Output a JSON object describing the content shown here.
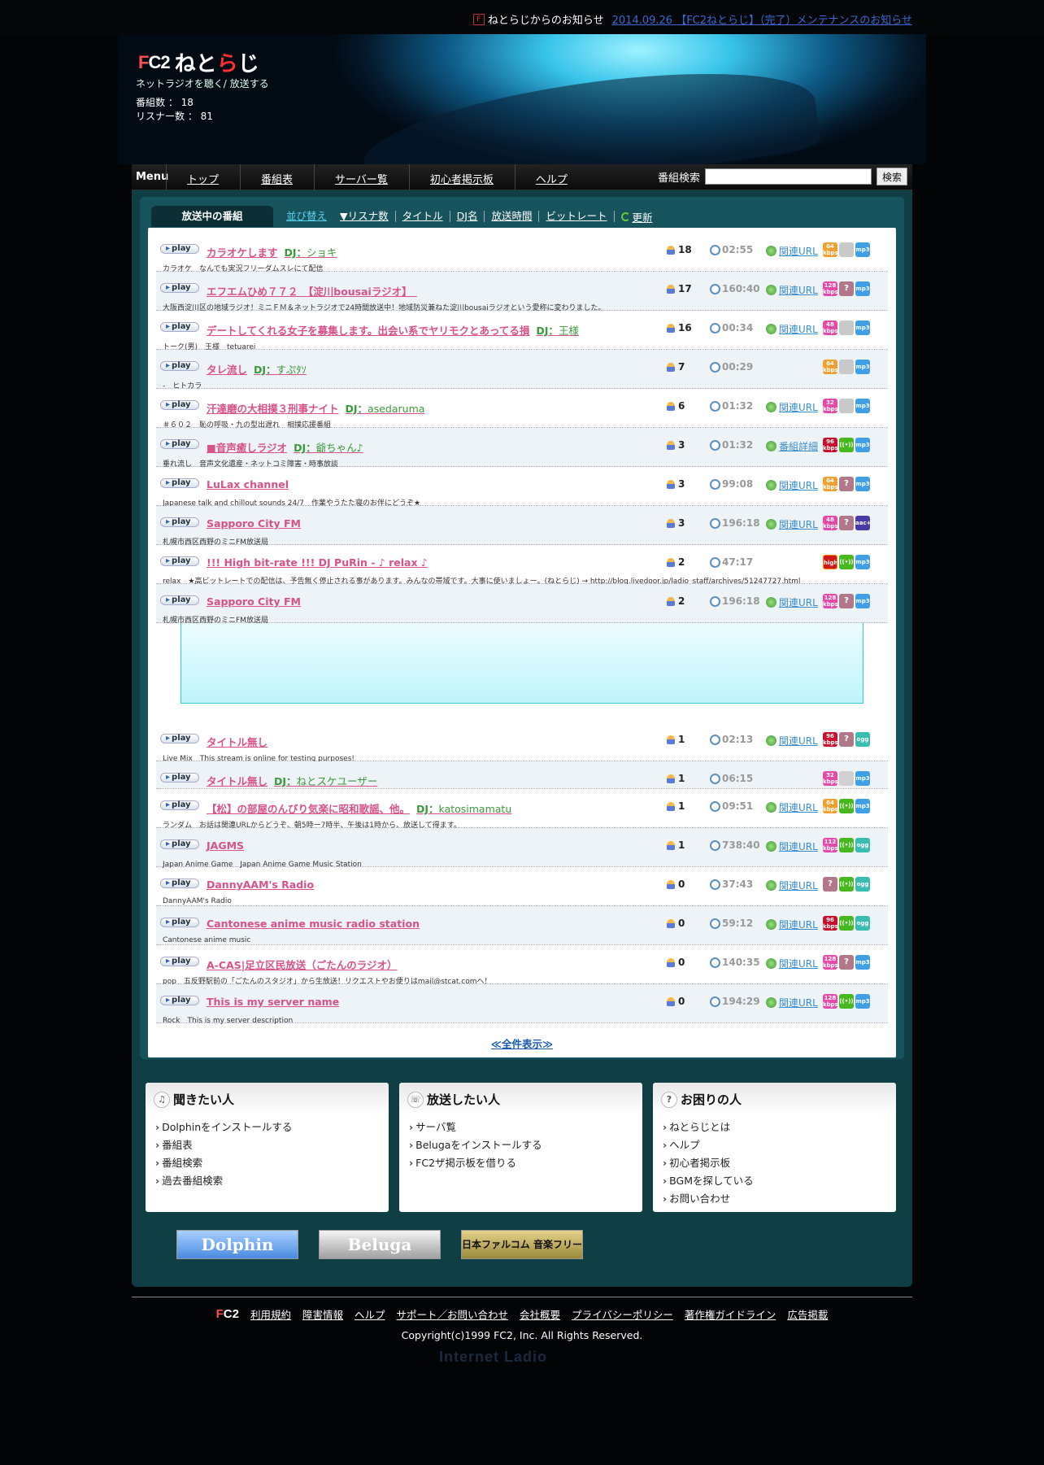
{
  "topbar": {
    "site_notice_label": "ねとらじからのお知らせ",
    "notice_link": "2014.09.26 【FC2ねとらじ】（完了）メンテナンスのお知らせ"
  },
  "header": {
    "logo_fc2": "FC2",
    "logo_jp": "ねとらじ",
    "tagline": "ネットラジオを聴く/ 放送する",
    "program_count": "番組数 ： 18",
    "listener_count": "リスナー数 ： 81"
  },
  "nav": {
    "menu_label": "Menu",
    "items": [
      "トップ",
      "番組表",
      "サーバー覧",
      "初心者掲示板",
      "ヘルプ"
    ],
    "search_label": "番組検索",
    "search_button": "検索"
  },
  "list": {
    "tab_label": "放送中の番組",
    "sort_label": "並び替え",
    "sort_options": [
      "▼リスナ数",
      "タイトル",
      "DJ名",
      "放送時間",
      "ビットレート"
    ],
    "refresh_label": "更新",
    "play_label": "play",
    "show_all": "≪全件表示≫",
    "rows": [
      {
        "title": "カラオケしますDJ：ショキ",
        "desc": "カラオケ　なんでも実況フリーダムスレにて配信",
        "listeners": "18",
        "time": "02:55",
        "link": "関連URL",
        "badges": [
          [
            "orange",
            "64 kbps"
          ],
          [
            "gray",
            ""
          ],
          [
            "mp3",
            "mp3"
          ]
        ]
      },
      {
        "title": "エフエムひめ７７２　【淀川bousaiラジオ】　",
        "desc": "大阪西淀川区の地域ラジオ！ミニＦＭ＆ネットラジオで24時間放送中！地域防災兼ねた淀川bousaiラジオという愛称に変わりました。",
        "listeners": "17",
        "time": "160:40",
        "link": "関連URL",
        "badges": [
          [
            "pink",
            "128 kbps"
          ],
          [
            "q",
            "?"
          ],
          [
            "mp3",
            "mp3"
          ]
        ]
      },
      {
        "title": "デートしてくれる女子を募集します。出会い系でヤリモクとあってる損DJ：王様",
        "desc": "トーク(男)　王様　tetuarei",
        "listeners": "16",
        "time": "00:34",
        "link": "関連URL",
        "badges": [
          [
            "pink",
            "48 kbps"
          ],
          [
            "gray",
            ""
          ],
          [
            "mp3",
            "mp3"
          ]
        ]
      },
      {
        "title": "タレ流しDJ：すぷﾀｿ",
        "desc": "-　ヒトカラ",
        "listeners": "7",
        "time": "00:29",
        "link": "",
        "badges": [
          [
            "orange",
            "64 kbps"
          ],
          [
            "gray",
            ""
          ],
          [
            "mp3",
            "mp3"
          ]
        ]
      },
      {
        "title": "汗達磨の大相撲３刑事ナイトDJ：asedaruma",
        "desc": "＃６０２　恥の呼吸・九の型出遅れ　相撲応援番組",
        "listeners": "6",
        "time": "01:32",
        "link": "関連URL",
        "badges": [
          [
            "pink",
            "32 kbps"
          ],
          [
            "gray",
            ""
          ],
          [
            "mp3",
            "mp3"
          ]
        ]
      },
      {
        "title": "■音声癒しラジオDJ：爺ちゃん♪",
        "desc": "垂れ流し　音声文化遺産・ネットコミ障害・時事放談",
        "listeners": "3",
        "time": "01:32",
        "link": "番組詳細",
        "badges": [
          [
            "red",
            "96 kbps"
          ],
          [
            "green",
            "((•))"
          ],
          [
            "mp3",
            "mp3"
          ]
        ]
      },
      {
        "title": "LuLax channel",
        "desc": "Japanese talk and chillout sounds 24/7　作業やうたた寝のお伴にどうぞ★",
        "listeners": "3",
        "time": "99:08",
        "link": "関連URL",
        "badges": [
          [
            "orange",
            "64 kbps"
          ],
          [
            "q",
            "?"
          ],
          [
            "mp3",
            "mp3"
          ]
        ]
      },
      {
        "title": "Sapporo City FM",
        "desc": "札幌市西区西野のミニFM放送局",
        "listeners": "3",
        "time": "196:18",
        "link": "関連URL",
        "badges": [
          [
            "pink",
            "48 kbps"
          ],
          [
            "q",
            "?"
          ],
          [
            "aac",
            "aac+"
          ]
        ]
      },
      {
        "title": "!!! High bit-rate !!! DJ PuRin - ♪ relax ♪",
        "desc": "relax　★高ビットレートでの配信は、予告無く停止される事があります。みんなの帯域です。大事に使いましょー。(ねとらじ) → http://blog.livedoor.jp/ladio_staff/archives/51247727.html",
        "listeners": "2",
        "time": "47:17",
        "link": "",
        "badges": [
          [
            "high",
            "high"
          ],
          [
            "green",
            "((•))"
          ],
          [
            "mp3",
            "mp3"
          ]
        ]
      },
      {
        "title": "Sapporo City FM",
        "desc": "札幌市西区西野のミニFM放送局",
        "listeners": "2",
        "time": "196:18",
        "link": "関連URL",
        "badges": [
          [
            "pink",
            "128 kbps"
          ],
          [
            "q",
            "?"
          ],
          [
            "mp3",
            "mp3"
          ]
        ]
      },
      {
        "title": "タイトル無し",
        "desc": "Live Mix　This stream is online for testing purposes!",
        "listeners": "1",
        "time": "02:13",
        "link": "関連URL",
        "badges": [
          [
            "red",
            "96 kbps"
          ],
          [
            "q",
            "?"
          ],
          [
            "ogg",
            "ogg"
          ]
        ]
      },
      {
        "title": "タイトル無しDJ：ねとスケユーザー",
        "desc": "",
        "listeners": "1",
        "time": "06:15",
        "link": "",
        "badges": [
          [
            "pink",
            "32 kbps"
          ],
          [
            "lgray",
            ""
          ],
          [
            "mp3",
            "mp3"
          ]
        ]
      },
      {
        "title": "【松】の部屋のんびり気楽に昭和歌謡、他。DJ：katosimamatu",
        "desc": "ランダム　お話は関連URLからどうぞ、朝5時ー7時半、午後は1時から、放送して得ます。",
        "listeners": "1",
        "time": "09:51",
        "link": "関連URL",
        "badges": [
          [
            "orange",
            "64 kbps"
          ],
          [
            "green",
            "((•))"
          ],
          [
            "mp3",
            "mp3"
          ]
        ]
      },
      {
        "title": "JAGMS",
        "desc": "Japan Anime Game　Japan Anime Game Music Station",
        "listeners": "1",
        "time": "738:40",
        "link": "関連URL",
        "badges": [
          [
            "pink",
            "112 kbps"
          ],
          [
            "green",
            "((•))"
          ],
          [
            "ogg",
            "ogg"
          ]
        ]
      },
      {
        "title": "DannyAAM's Radio",
        "desc": "DannyAAM's Radio",
        "listeners": "0",
        "time": "37:43",
        "link": "関連URL",
        "badges": [
          [
            "q",
            "?"
          ],
          [
            "green",
            "((•))"
          ],
          [
            "ogg",
            "ogg"
          ]
        ]
      },
      {
        "title": "Cantonese anime music radio station",
        "desc": "Cantonese anime music",
        "listeners": "0",
        "time": "59:12",
        "link": "関連URL",
        "badges": [
          [
            "red",
            "96 kbps"
          ],
          [
            "green",
            "((•))"
          ],
          [
            "ogg",
            "ogg"
          ]
        ]
      },
      {
        "title": "A-CAS|足立区民放送（ごたんのラジオ）",
        "desc": "pop　五反野駅前の「ごたんのスタジオ」から生放送！リクエストやお便りはmail@stcat.comへ！",
        "listeners": "0",
        "time": "140:35",
        "link": "関連URL",
        "badges": [
          [
            "pink",
            "128 kbps"
          ],
          [
            "q",
            "?"
          ],
          [
            "mp3",
            "mp3"
          ]
        ]
      },
      {
        "title": "This is my server name",
        "desc": "Rock　This is my server description",
        "listeners": "0",
        "time": "194:29",
        "link": "関連URL",
        "badges": [
          [
            "pink",
            "128 kbps"
          ],
          [
            "green",
            "((•))"
          ],
          [
            "mp3",
            "mp3"
          ]
        ]
      }
    ]
  },
  "boxes": [
    {
      "title": "聞きたい人",
      "icon": "♫",
      "items": [
        "Dolphinをインストールする",
        "番組表",
        "番組検索",
        "過去番組検索"
      ]
    },
    {
      "title": "放送したい人",
      "icon": "☏",
      "items": [
        "サーバ覧",
        "Belugaをインストールする",
        "FC2ザ掲示板を借りる"
      ]
    },
    {
      "title": "お困りの人",
      "icon": "?",
      "items": [
        "ねとらじとは",
        "ヘルプ",
        "初心者掲示板",
        "BGMを探している",
        "お問い合わせ"
      ]
    }
  ],
  "banners": [
    "Dolphin",
    "Beluga",
    "日本ファルコム 音楽フリー"
  ],
  "footer": {
    "logo": "FC2",
    "links": [
      "利用規約",
      "障害情報",
      "ヘルプ",
      "サポート／お問い合わせ",
      "会社概要",
      "プライバシーポリシー",
      "著作権ガイドライン",
      "広告掲載"
    ],
    "copyright": "Copyright(c)1999 FC2, Inc. All Rights Reserved.",
    "bg_logo": "Internet Ladio"
  }
}
